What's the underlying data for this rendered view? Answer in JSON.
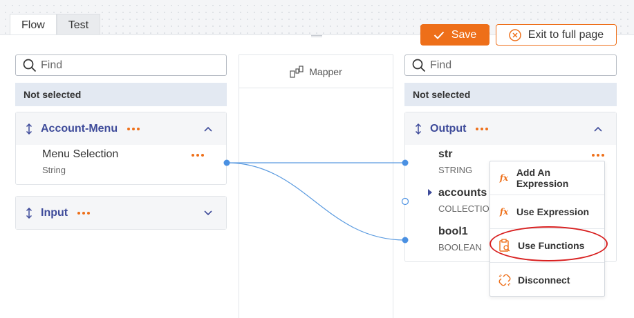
{
  "tabs": [
    {
      "label": "Flow",
      "active": true
    },
    {
      "label": "Test",
      "active": false
    }
  ],
  "toolbar": {
    "save_label": "Save",
    "exit_label": "Exit to full page"
  },
  "source": {
    "search_placeholder": "Find",
    "selection_status": "Not selected",
    "groups": [
      {
        "title": "Account-Menu",
        "expanded": true,
        "fields": [
          {
            "name": "Menu Selection",
            "type": "String"
          }
        ]
      },
      {
        "title": "Input",
        "expanded": false,
        "fields": []
      }
    ]
  },
  "mapper": {
    "label": "Mapper"
  },
  "target": {
    "search_placeholder": "Find",
    "selection_status": "Not selected",
    "group": {
      "title": "Output",
      "expanded": true,
      "fields": [
        {
          "name": "str",
          "type": "STRING"
        },
        {
          "name": "accounts",
          "type": "COLLECTION"
        },
        {
          "name": "bool1",
          "type": "BOOLEAN"
        }
      ]
    }
  },
  "context_menu": {
    "items": [
      {
        "label": "Add An Expression",
        "icon": "fx-icon"
      },
      {
        "label": "Use Expression",
        "icon": "fx-icon"
      },
      {
        "label": "Use Functions",
        "icon": "function-clipboard-icon",
        "highlighted": true
      },
      {
        "label": "Disconnect",
        "icon": "unlink-icon"
      }
    ]
  },
  "colors": {
    "accent": "#ee6f19",
    "title": "#3e4b9a",
    "wire": "#5b9be0",
    "highlight": "#d81f1f"
  }
}
